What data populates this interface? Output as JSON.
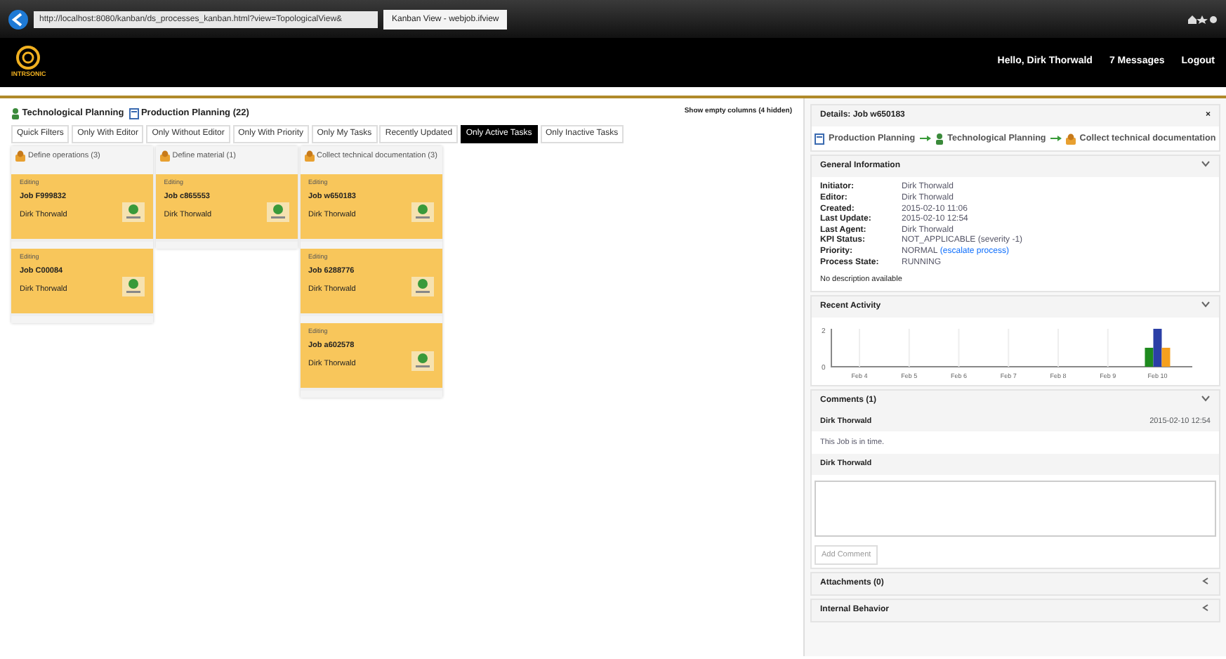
{
  "browser": {
    "address": "http://localhost:8080/kanban/ds_processes_kanban.html?view=TopologicalView&",
    "tab_title": "Kanban View - webjob.ifview"
  },
  "header": {
    "brand": "INTRSONIC",
    "greeting": "Hello, Dirk Thorwald",
    "messages": "7 Messages",
    "logout": "Logout"
  },
  "board": {
    "breadcrumb": [
      {
        "label": "Technological Planning",
        "kind": "person"
      },
      {
        "label": "Production Planning (22)",
        "kind": "doc"
      }
    ],
    "show_empty": "Show empty columns (4 hidden)",
    "filters": [
      {
        "label": "Quick Filters",
        "selected": false
      },
      {
        "label": "Only With Editor",
        "selected": false
      },
      {
        "label": "Only Without Editor",
        "selected": false
      },
      {
        "label": "Only With Priority",
        "selected": false
      },
      {
        "label": "Only My Tasks",
        "selected": false
      },
      {
        "label": "Recently Updated",
        "selected": false
      },
      {
        "label": "Only Active Tasks",
        "selected": true
      },
      {
        "label": "Only Inactive Tasks",
        "selected": false
      }
    ],
    "columns": [
      {
        "title": "Define operations (3)",
        "cards": [
          {
            "status": "Editing",
            "job": "Job F999832",
            "editor": "Dirk Thorwald"
          },
          {
            "status": "Editing",
            "job": "Job C00084",
            "editor": "Dirk Thorwald"
          }
        ]
      },
      {
        "title": "Define material (1)",
        "cards": [
          {
            "status": "Editing",
            "job": "Job c865553",
            "editor": "Dirk Thorwald"
          }
        ]
      },
      {
        "title": "Collect technical documentation (3)",
        "cards": [
          {
            "status": "Editing",
            "job": "Job w650183",
            "editor": "Dirk Thorwald"
          },
          {
            "status": "Editing",
            "job": "Job 6288776",
            "editor": "Dirk Thorwald"
          },
          {
            "status": "Editing",
            "job": "Job a602578",
            "editor": "Dirk Thorwald"
          }
        ]
      }
    ]
  },
  "details": {
    "title": "Details: Job w650183",
    "close": "×",
    "path": [
      {
        "label": "Production Planning",
        "kind": "doc"
      },
      {
        "label": "Technological Planning",
        "kind": "person"
      },
      {
        "label": "Collect technical documentation",
        "kind": "task"
      }
    ],
    "general": {
      "title": "General Information",
      "expanded": true,
      "rows": [
        {
          "label": "Initiator:",
          "value": "Dirk Thorwald"
        },
        {
          "label": "Editor:",
          "value": "Dirk Thorwald"
        },
        {
          "label": "Created:",
          "value": "2015-02-10 11:06"
        },
        {
          "label": "Last Update:",
          "value": "2015-02-10 12:54"
        },
        {
          "label": "Last Agent:",
          "value": "Dirk Thorwald"
        },
        {
          "label": "KPI Status:",
          "value": "NOT_APPLICABLE (severity -1)"
        },
        {
          "label": "Priority:",
          "value": "NORMAL",
          "link": "(escalate process)"
        },
        {
          "label": "Process State:",
          "value": "RUNNING"
        }
      ],
      "note": "No description available"
    },
    "activity": {
      "title": "Recent Activity",
      "expanded": true,
      "chart_data": {
        "type": "bar",
        "categories": [
          "Feb 4",
          "Feb 5",
          "Feb 6",
          "Feb 7",
          "Feb 8",
          "Feb 9",
          "Feb 10"
        ],
        "yticks": [
          0,
          2
        ],
        "ylim": [
          0,
          2
        ],
        "grid": true,
        "series": [
          {
            "color": "#1e8a1e",
            "values": [
              null,
              null,
              null,
              null,
              null,
              null,
              1
            ]
          },
          {
            "color": "#2b3fa6",
            "values": [
              null,
              null,
              null,
              null,
              null,
              null,
              2
            ]
          },
          {
            "color": "#f5a01e",
            "values": [
              null,
              null,
              null,
              null,
              null,
              null,
              1
            ]
          }
        ]
      }
    },
    "comments": {
      "title": "Comments (1)",
      "expanded": true,
      "items": [
        {
          "author": "Dirk Thorwald",
          "time": "2015-02-10 12:54",
          "text": "This Job is in time."
        }
      ],
      "new_author": "Dirk Thorwald",
      "button": "Add Comment"
    },
    "collapsed": [
      {
        "title": "Attachments (0)",
        "expanded": false
      },
      {
        "title": "Internal Behavior",
        "expanded": false
      }
    ]
  }
}
